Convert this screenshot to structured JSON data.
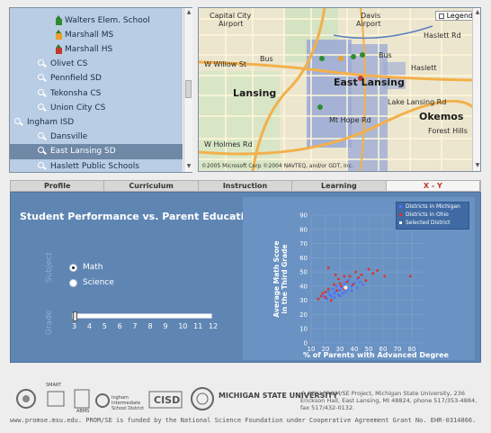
{
  "tree": {
    "items": [
      {
        "label": "Walters Elem. School",
        "type": "school",
        "color": "#2e8b2e",
        "indent": 2,
        "selected": false
      },
      {
        "label": "Marshall MS",
        "type": "school",
        "color": "#e8a02a",
        "indent": 2,
        "selected": false
      },
      {
        "label": "Marshall HS",
        "type": "school",
        "color": "#c0392b",
        "indent": 2,
        "selected": false
      },
      {
        "label": "Olivet CS",
        "type": "district",
        "indent": 1,
        "selected": false
      },
      {
        "label": "Pennfield SD",
        "type": "district",
        "indent": 1,
        "selected": false
      },
      {
        "label": "Tekonsha CS",
        "type": "district",
        "indent": 1,
        "selected": false
      },
      {
        "label": "Union City CS",
        "type": "district",
        "indent": 1,
        "selected": false
      },
      {
        "label": "Ingham ISD",
        "type": "isd",
        "indent": 0,
        "selected": false
      },
      {
        "label": "Dansville",
        "type": "district",
        "indent": 1,
        "selected": false
      },
      {
        "label": "East Lansing SD",
        "type": "district",
        "indent": 1,
        "selected": true
      },
      {
        "label": "Haslett Public Schools",
        "type": "district",
        "indent": 1,
        "selected": false
      }
    ]
  },
  "map": {
    "legend_label": "Legend",
    "labels": [
      {
        "text": "Capital City",
        "cls": ""
      },
      {
        "text": "Airport",
        "cls": ""
      },
      {
        "text": "Davis",
        "cls": ""
      },
      {
        "text": "Airport",
        "cls": ""
      },
      {
        "text": "W Willow St",
        "cls": ""
      },
      {
        "text": "Bus",
        "cls": ""
      },
      {
        "text": "Bus",
        "cls": ""
      },
      {
        "text": "Haslett",
        "cls": ""
      },
      {
        "text": "Lansing",
        "cls": "big"
      },
      {
        "text": "East Lansing",
        "cls": "big"
      },
      {
        "text": "Okemos",
        "cls": "big"
      },
      {
        "text": "Mt Hope Rd",
        "cls": ""
      },
      {
        "text": "W Holmes Rd",
        "cls": ""
      },
      {
        "text": "Forest Hills",
        "cls": ""
      },
      {
        "text": "Haslett Rd",
        "cls": ""
      },
      {
        "text": "Lake Lansing Rd",
        "cls": ""
      }
    ],
    "copyright": "©2005 Microsoft Corp ©2004 NAVTEQ, and/or GDT, Inc."
  },
  "tabs": [
    {
      "label": "Profile",
      "active": false
    },
    {
      "label": "Curriculum",
      "active": false
    },
    {
      "label": "Instruction",
      "active": false
    },
    {
      "label": "Learning",
      "active": false
    },
    {
      "label": "X - Y",
      "active": true
    }
  ],
  "content": {
    "title": "Student Performance vs. Parent Education",
    "subject_label": "Subject",
    "grade_label": "Grade",
    "subjects": [
      {
        "label": "Math",
        "selected": true
      },
      {
        "label": "Science",
        "selected": false
      }
    ],
    "grades": [
      "3",
      "4",
      "5",
      "6",
      "7",
      "8",
      "9",
      "10",
      "11",
      "12"
    ],
    "selected_grade": "3"
  },
  "chart_data": {
    "type": "scatter",
    "title": "",
    "xlabel": "% of Parents with Advanced Degree",
    "ylabel": "Average Math Score in the Third Grade",
    "xlim": [
      10,
      90
    ],
    "ylim": [
      0,
      90
    ],
    "xticks": [
      10,
      20,
      30,
      40,
      50,
      60,
      70,
      80
    ],
    "yticks": [
      0,
      10,
      20,
      30,
      40,
      50,
      60,
      70,
      80,
      90
    ],
    "legend": {
      "placement": "top-right",
      "entries": [
        {
          "name": "Districts in Michigan",
          "color": "#4a73ff"
        },
        {
          "name": "Districts in Ohio",
          "color": "#e0302c"
        },
        {
          "name": "Selected District",
          "color": "#ffffff"
        }
      ]
    },
    "series": [
      {
        "name": "Districts in Michigan",
        "color": "#4a73ff",
        "points": [
          [
            19,
            33
          ],
          [
            21,
            31
          ],
          [
            22,
            36
          ],
          [
            23,
            34
          ],
          [
            24,
            33
          ],
          [
            25,
            38
          ],
          [
            26,
            32
          ],
          [
            27,
            36
          ],
          [
            28,
            40
          ],
          [
            29,
            34
          ],
          [
            30,
            37
          ],
          [
            31,
            39
          ],
          [
            32,
            35
          ],
          [
            33,
            42
          ],
          [
            35,
            38
          ],
          [
            36,
            44
          ],
          [
            38,
            40
          ],
          [
            40,
            42
          ],
          [
            42,
            45
          ],
          [
            44,
            43
          ],
          [
            46,
            41
          ],
          [
            34,
            36
          ],
          [
            30,
            33
          ],
          [
            26,
            35
          ],
          [
            38,
            37
          ],
          [
            42,
            39
          ]
        ]
      },
      {
        "name": "Districts in Ohio",
        "color": "#e0302c",
        "points": [
          [
            15,
            31
          ],
          [
            17,
            33
          ],
          [
            18,
            35
          ],
          [
            20,
            32
          ],
          [
            22,
            38
          ],
          [
            24,
            30
          ],
          [
            26,
            41
          ],
          [
            28,
            37
          ],
          [
            29,
            45
          ],
          [
            31,
            40
          ],
          [
            33,
            38
          ],
          [
            35,
            43
          ],
          [
            37,
            47
          ],
          [
            39,
            41
          ],
          [
            41,
            50
          ],
          [
            43,
            46
          ],
          [
            45,
            48
          ],
          [
            48,
            44
          ],
          [
            50,
            52
          ],
          [
            53,
            49
          ],
          [
            56,
            51
          ],
          [
            61,
            47
          ],
          [
            79,
            47
          ],
          [
            22,
            53
          ],
          [
            27,
            48
          ],
          [
            33,
            47
          ],
          [
            20,
            36
          ],
          [
            30,
            42
          ]
        ]
      },
      {
        "name": "Selected District",
        "color": "#ffffff",
        "points": [
          [
            34,
            39
          ]
        ]
      }
    ]
  },
  "footer": {
    "logos": [
      "MSU",
      "SMART",
      "ABMS",
      "Ingham Intermediate School District",
      "CISD",
      "MICHIGAN STATE UNIVERSITY"
    ],
    "text": "© MSU PROM/SE Project, Michigan State University, 236 Erickson Hall, East Lansing, MI 48824, phone 517/353-4884, fax 517/432-0132.",
    "bottom": "www.promse.msu.edu. PROM/SE is funded by the National Science Foundation under Cooperative Agreement Grant No. EHR-0314866."
  }
}
